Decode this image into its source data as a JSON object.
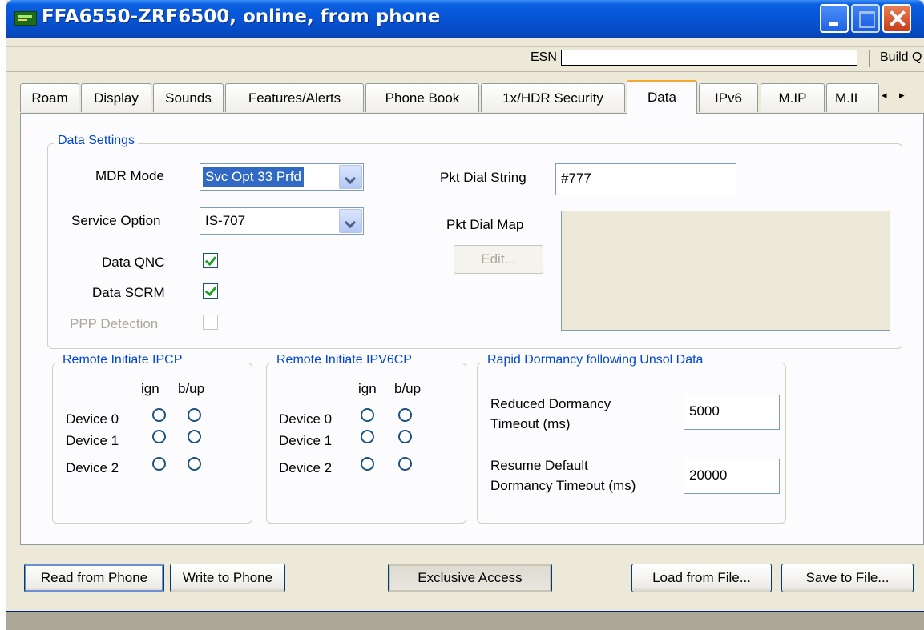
{
  "window": {
    "title": "FFA6550-ZRF6500, online, from phone",
    "icon": "phone-app-icon",
    "controls": [
      "minimize-icon",
      "maximize-icon",
      "close-icon"
    ]
  },
  "infobar": {
    "esn_label": "ESN",
    "esn_value": "",
    "build_label": "Build Q"
  },
  "tabs": [
    {
      "label": "Roam",
      "active": false
    },
    {
      "label": "Display",
      "active": false
    },
    {
      "label": "Sounds",
      "active": false
    },
    {
      "label": "Features/Alerts",
      "active": false
    },
    {
      "label": "Phone Book",
      "active": false
    },
    {
      "label": "1x/HDR Security",
      "active": false
    },
    {
      "label": "Data",
      "active": true
    },
    {
      "label": "IPv6",
      "active": false
    },
    {
      "label": "M.IP",
      "active": false
    },
    {
      "label": "M.II",
      "active": false
    }
  ],
  "tab_scroll": {
    "left": "◂",
    "right": "▸"
  },
  "data_settings": {
    "title": "Data Settings",
    "mdr_mode_label": "MDR Mode",
    "mdr_mode_value": "Svc Opt 33 Prfd",
    "service_option_label": "Service Option",
    "service_option_value": "IS-707",
    "data_qnc_label": "Data QNC",
    "data_qnc_checked": true,
    "data_scrm_label": "Data SCRM",
    "data_scrm_checked": true,
    "ppp_detection_label": "PPP Detection",
    "ppp_detection_checked": false,
    "pkt_dial_string_label": "Pkt Dial String",
    "pkt_dial_string_value": "#777",
    "pkt_dial_map_label": "Pkt Dial Map",
    "edit_button": "Edit..."
  },
  "remote_ipcp": {
    "title": "Remote Initiate IPCP",
    "col_ign": "ign",
    "col_bup": "b/up",
    "devices": [
      "Device 0",
      "Device 1",
      "Device 2"
    ]
  },
  "remote_ipv6cp": {
    "title": "Remote Initiate IPV6CP",
    "col_ign": "ign",
    "col_bup": "b/up",
    "devices": [
      "Device 0",
      "Device 1",
      "Device 2"
    ]
  },
  "rapid_dormancy": {
    "title": "Rapid Dormancy following Unsol Data",
    "reduced_label_line1": "Reduced Dormancy",
    "reduced_label_line2": "Timeout (ms)",
    "reduced_value": "5000",
    "resume_label_line1": "Resume Default",
    "resume_label_line2": "Dormancy Timeout (ms)",
    "resume_value": "20000"
  },
  "buttons": {
    "read_from_phone": "Read from Phone",
    "write_to_phone": "Write to Phone",
    "exclusive_access": "Exclusive Access",
    "load_from_file": "Load from File...",
    "save_to_file": "Save to File..."
  },
  "colors": {
    "titlebar": "#0754d4",
    "group_label": "#0046d5",
    "active_tab_accent": "#f4a830",
    "check_mark": "#21a121",
    "selection": "#316ac5"
  }
}
